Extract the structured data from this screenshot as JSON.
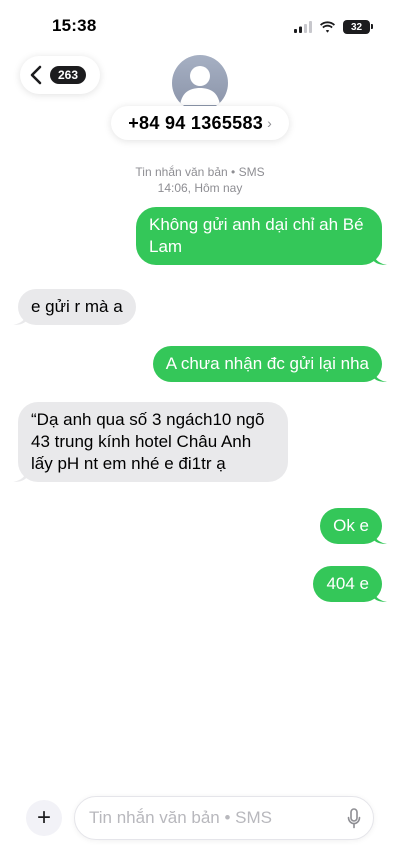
{
  "status_bar": {
    "time": "15:38",
    "battery": "32"
  },
  "header": {
    "back_count": "263",
    "contact_number": "+84 94 1365583",
    "contact_chevron": "›"
  },
  "conversation": {
    "service_label": "Tin nhắn văn bản • SMS",
    "timestamp": "14:06, Hôm nay",
    "messages": [
      {
        "direction": "outgoing",
        "text": "Không gửi anh dại chỉ ah Bé Lam"
      },
      {
        "direction": "incoming",
        "text": "e gửi r mà a"
      },
      {
        "direction": "outgoing",
        "text": "A chưa nhận đc gửi lại nha"
      },
      {
        "direction": "incoming",
        "text": "“Dạ anh qua số 3 ngách10 ngõ 43 trung kính hotel Châu Anh lấy pH nt em nhé e đi1tr ạ"
      },
      {
        "direction": "outgoing",
        "text": "Ok e"
      },
      {
        "direction": "outgoing",
        "text": "404 e"
      }
    ]
  },
  "composer": {
    "plus_label": "+",
    "placeholder": "Tin nhắn văn bản • SMS"
  },
  "icons": {
    "back": "chevron-left-icon",
    "signal": "cellular-signal-icon",
    "wifi": "wifi-icon",
    "battery": "battery-icon",
    "avatar": "person-icon",
    "mic": "microphone-icon",
    "plus": "plus-icon"
  },
  "colors": {
    "outgoing_bubble": "#34c759",
    "incoming_bubble": "#e9e9eb",
    "secondary_text": "#8e8e93"
  }
}
